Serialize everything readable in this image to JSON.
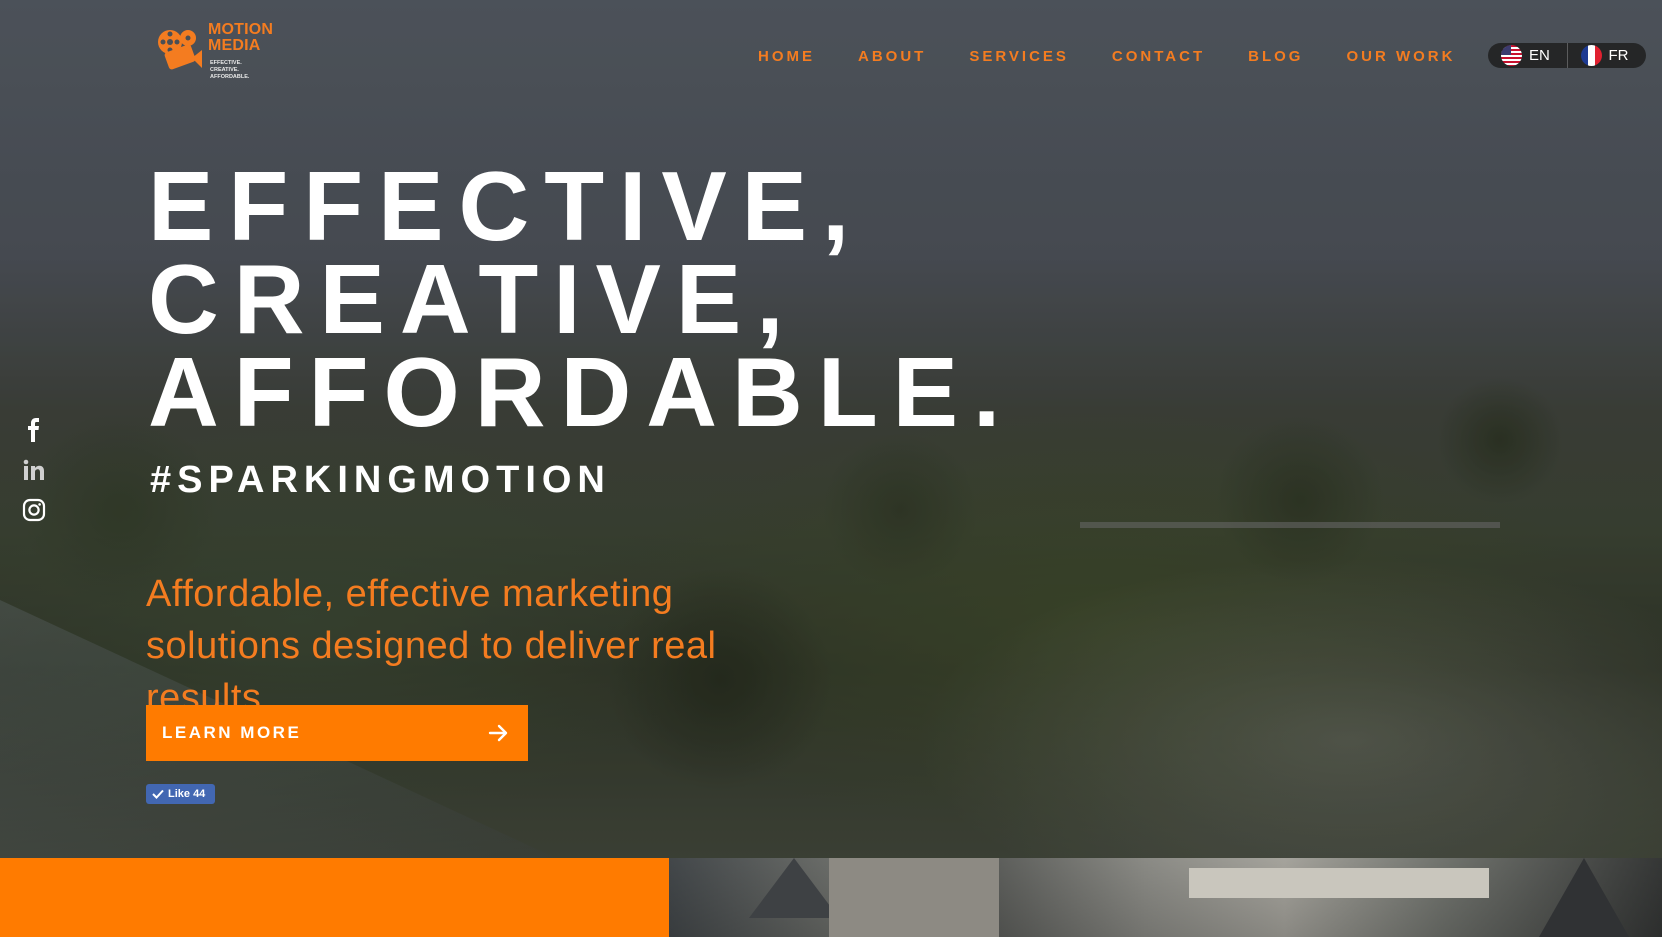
{
  "brand": {
    "name_line1": "MOTION",
    "name_line2": "MEDIA",
    "tagline": [
      "EFFECTIVE.",
      "CREATIVE.",
      "AFFORDABLE."
    ],
    "color": "#f47c20"
  },
  "nav": {
    "items": [
      {
        "label": "HOME"
      },
      {
        "label": "ABOUT"
      },
      {
        "label": "SERVICES"
      },
      {
        "label": "CONTACT"
      },
      {
        "label": "BLOG"
      },
      {
        "label": "OUR WORK"
      }
    ]
  },
  "language": {
    "options": [
      {
        "code": "EN",
        "flag": "us-flag-icon"
      },
      {
        "code": "FR",
        "flag": "fr-flag-icon"
      }
    ]
  },
  "hero": {
    "headline": [
      "EFFECTIVE,",
      "CREATIVE,",
      "AFFORDABLE."
    ],
    "hashtag": "#SPARKINGMOTION",
    "subtext": "Affordable, effective marketing solutions designed to deliver real results",
    "cta_label": "LEARN MORE",
    "fb_like": "Like 44"
  },
  "social": {
    "icons": [
      "facebook-icon",
      "linkedin-icon",
      "instagram-icon"
    ]
  },
  "colors": {
    "accent": "#ff7b00",
    "text_light": "#ffffff"
  }
}
